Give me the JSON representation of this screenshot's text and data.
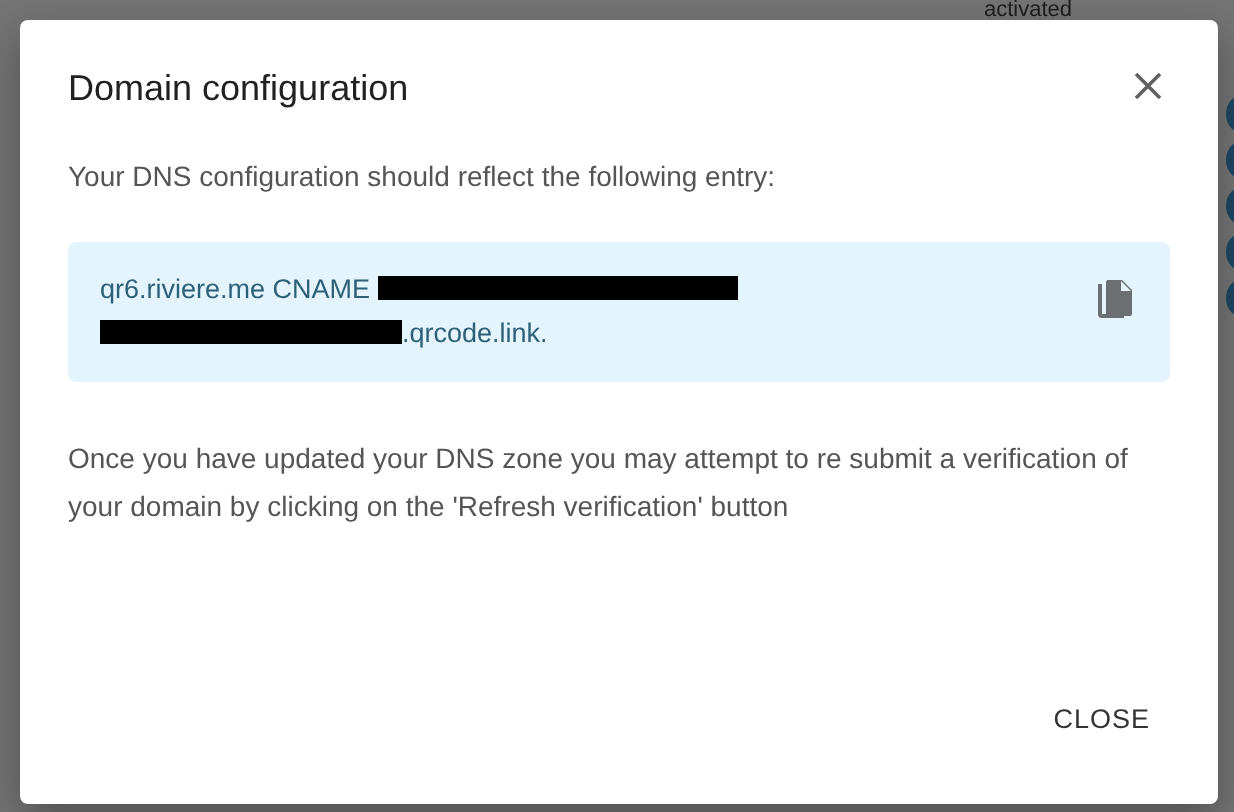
{
  "background": {
    "status_text": "activated"
  },
  "dialog": {
    "title": "Domain configuration",
    "intro": "Your DNS configuration should reflect the following entry:",
    "record": {
      "host": "qr6.riviere.me CNAME",
      "target_suffix": ".qrcode.link."
    },
    "help": "Once you have updated your DNS zone you may attempt to re submit a verification of your domain by clicking on the 'Refresh verification' button",
    "buttons": [
      "CLOSE"
    ]
  }
}
